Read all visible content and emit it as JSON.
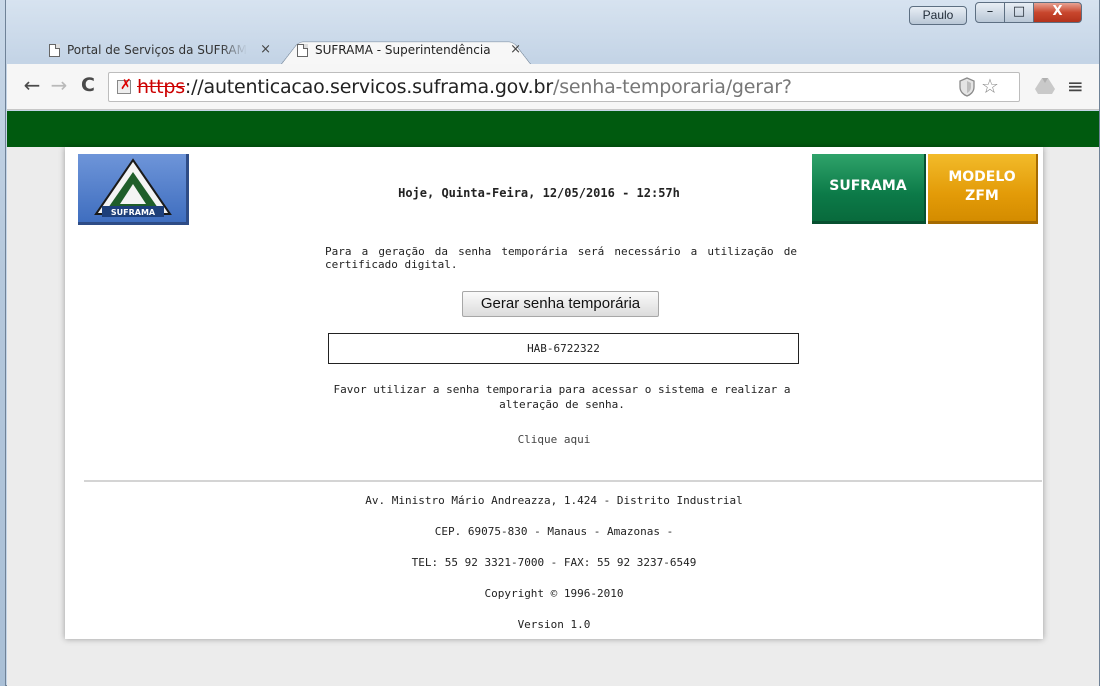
{
  "window": {
    "user_label": "Paulo",
    "minimize_label": "–",
    "maximize_label": "□",
    "close_label": "X"
  },
  "tabs": [
    {
      "label": "Portal de Serviços da SUFRAMA",
      "close": "×"
    },
    {
      "label": "SUFRAMA - Superintendência",
      "close": "×"
    }
  ],
  "toolbar": {
    "back": "←",
    "forward": "→",
    "reload": "C",
    "url_scheme": "https",
    "url_sep": "://",
    "url_host": "autenticacao.servicos.suframa.gov.br",
    "url_path": "/senha-temporaria/gerar?",
    "star": "☆",
    "menu": "≡"
  },
  "header": {
    "date_line": "Hoje, Quinta-Feira, 12/05/2016 - 12:57h",
    "logo_text": "SUFRAMA",
    "btn_suframa": "SUFRAMA",
    "btn_zfm_1": "MODELO",
    "btn_zfm_2": "ZFM"
  },
  "main": {
    "info_text": "Para a geração da senha temporária será necessário a utilização de certificado digital.",
    "generate_button": "Gerar senha temporária",
    "temp_password": "HAB-6722322",
    "note_text": "Favor utilizar a senha temporaria para acessar o sistema e realizar a alteração de senha.",
    "click_here": "Clique aqui"
  },
  "footer": {
    "address": "Av. Ministro Mário Andreazza, 1.424 - Distrito Industrial",
    "cep": "CEP. 69075-830 - Manaus - Amazonas -",
    "phone": "TEL: 55 92 3321-7000 - FAX: 55 92 3237-6549",
    "copyright": "Copyright © 1996-2010",
    "version": "Version 1.0"
  },
  "colors": {
    "green_bar": "#005a0f",
    "suframa_green": "#0c7a48",
    "zfm_orange": "#e39b08",
    "logo_blue": "#3f6ebf"
  }
}
